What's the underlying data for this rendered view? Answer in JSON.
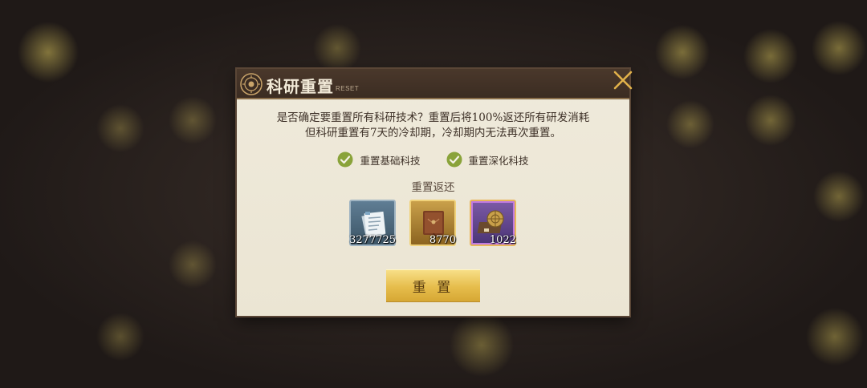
{
  "dialog": {
    "title": "科研重置",
    "subtitle": "RESET",
    "description_line1": "是否确定要重置所有科研技术？重置后将100%返还所有研发消耗",
    "description_line2": "但科研重置有7天的冷却期，冷却期内无法再次重置。",
    "options": [
      {
        "label": "重置基础科技",
        "checked": true
      },
      {
        "label": "重置深化科技",
        "checked": true
      }
    ],
    "return_label": "重置返还",
    "items": [
      {
        "icon": "document-stack-icon",
        "count": "3277725",
        "rarity_color": "#5f7d94"
      },
      {
        "icon": "leather-book-icon",
        "count": "8770",
        "rarity_color": "#c9a04a"
      },
      {
        "icon": "astrolabe-kit-icon",
        "count": "1022",
        "rarity_color": "#7c5aa6"
      }
    ],
    "reset_button": "重 置"
  },
  "colors": {
    "check_green": "#8aa33a",
    "close_gold": "#e2b24a",
    "button_gold": "#e6bd4c"
  }
}
